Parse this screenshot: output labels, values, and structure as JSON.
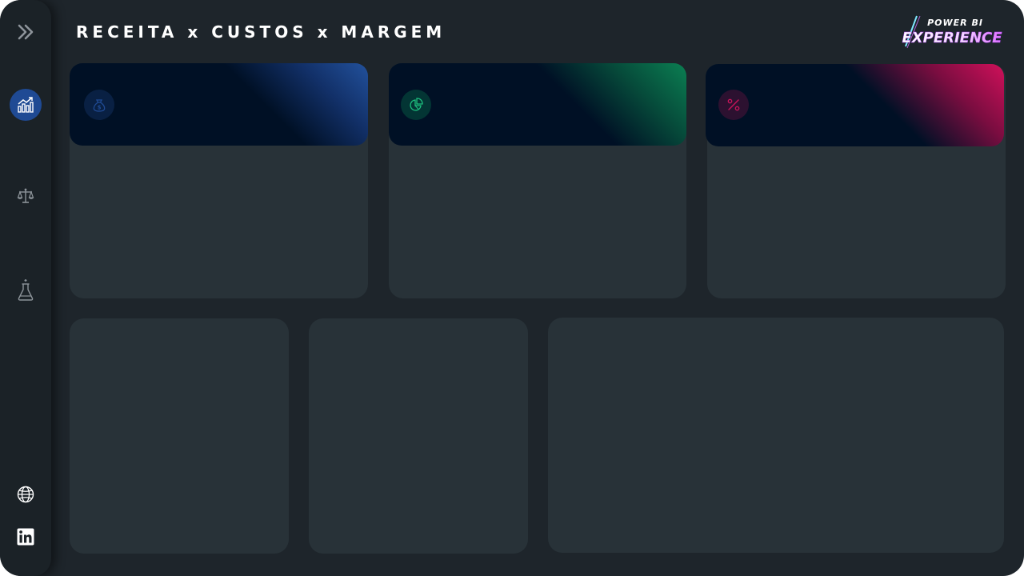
{
  "header": {
    "title": "RECEITA x CUSTOS x MARGEM"
  },
  "logo": {
    "line1": "POWER BI",
    "line2": "EXPERIENCE"
  },
  "sidebar": {
    "items": [
      {
        "icon": "chevron-double-right-icon"
      },
      {
        "icon": "trending-chart-icon",
        "active": true
      },
      {
        "icon": "balance-scale-icon"
      },
      {
        "icon": "flask-icon"
      },
      {
        "icon": "globe-icon"
      },
      {
        "icon": "linkedin-icon"
      }
    ]
  },
  "kpi_cards": [
    {
      "icon": "money-bag-icon",
      "accent": "#1f4a94"
    },
    {
      "icon": "pie-chart-icon",
      "accent": "#0a7a4f"
    },
    {
      "icon": "percent-icon",
      "accent": "#c8155a"
    }
  ],
  "colors": {
    "background": "#1e252b",
    "sidebar": "#1b2227",
    "card": "#283238",
    "kpi_header": "#001025",
    "active_nav": "#1f4a94"
  }
}
